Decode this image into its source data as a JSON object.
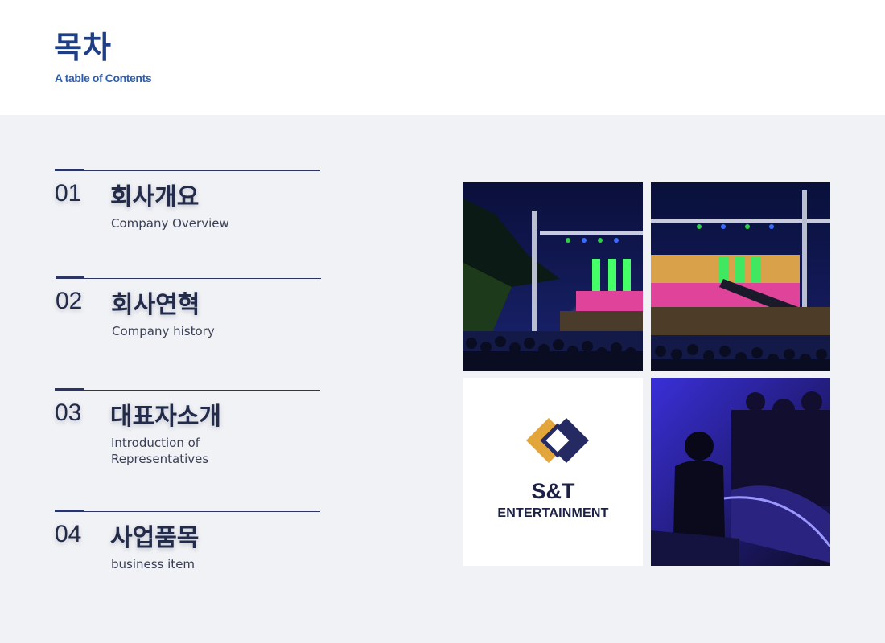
{
  "header": {
    "title": "목차",
    "subtitle": "A table of Contents"
  },
  "toc": [
    {
      "number": "01",
      "title": "회사개요",
      "subtitle": "Company Overview"
    },
    {
      "number": "02",
      "title": "회사연혁",
      "subtitle": "Company history"
    },
    {
      "number": "03",
      "title": "대표자소개",
      "subtitle": "Introduction of Representatives"
    },
    {
      "number": "04",
      "title": "사업품목",
      "subtitle": "business item"
    }
  ],
  "logo": {
    "name": "S&T",
    "sub": "ENTERTAINMENT"
  },
  "colors": {
    "title": "#1e3f86",
    "navy": "#232b4a",
    "logo_gold": "#e3a63a",
    "logo_navy": "#262a63"
  }
}
